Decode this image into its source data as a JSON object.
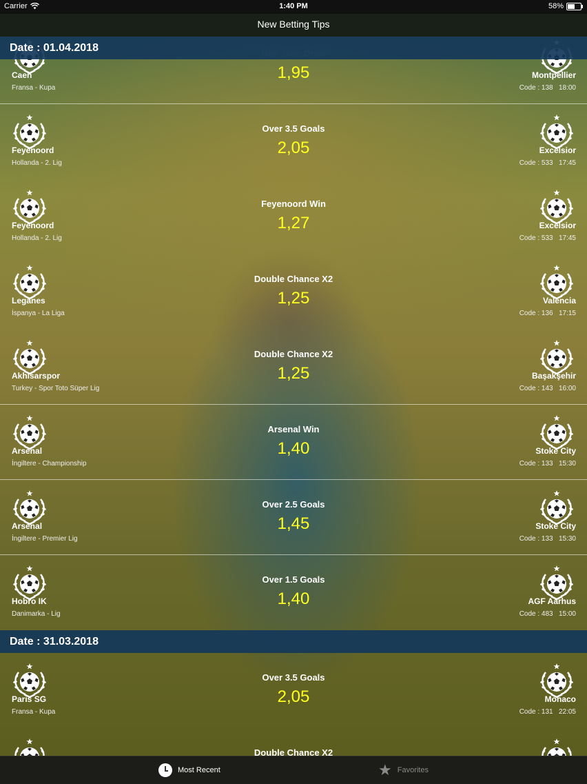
{
  "status_bar": {
    "carrier": "Carrier",
    "time": "1:40 PM",
    "battery": "58%",
    "battery_level": 0.58
  },
  "nav": {
    "title": "New Betting Tips"
  },
  "sections": [
    {
      "date": "Date : 01.04.2018",
      "matches": [
        {
          "home": "Caen",
          "league": "Fransa - Kupa",
          "tip": "Half Time Draw",
          "odds": "1,95",
          "away": "Montpellier",
          "code": "Code : 138",
          "time": "18:00"
        },
        {
          "home": "Feyenoord",
          "league": "Hollanda - 2. Lig",
          "tip": "Over 3.5 Goals",
          "odds": "2,05",
          "away": "Excelsior",
          "code": "Code : 533",
          "time": "17:45"
        },
        {
          "home": "Feyenoord",
          "league": "Hollanda - 2. Lig",
          "tip": "Feyenoord Win",
          "odds": "1,27",
          "away": "Excelsior",
          "code": "Code : 533",
          "time": "17:45"
        },
        {
          "home": "Leganes",
          "league": "İspanya - La Liga",
          "tip": "Double Chance X2",
          "odds": "1,25",
          "away": "Valencia",
          "code": "Code : 136",
          "time": "17:15"
        },
        {
          "home": "Akhisarspor",
          "league": "Turkey - Spor Toto Süper Lig",
          "tip": "Double Chance X2",
          "odds": "1,25",
          "away": "Başakşehir",
          "code": "Code : 143",
          "time": "16:00"
        },
        {
          "home": "Arsenal",
          "league": "İngiltere - Championship",
          "tip": "Arsenal Win",
          "odds": "1,40",
          "away": "Stoke City",
          "code": "Code : 133",
          "time": "15:30"
        },
        {
          "home": "Arsenal",
          "league": "İngiltere - Premier Lig",
          "tip": "Over 2.5 Goals",
          "odds": "1,45",
          "away": "Stoke City",
          "code": "Code : 133",
          "time": "15:30"
        },
        {
          "home": "Hobro IK",
          "league": "Danimarka - Lig",
          "tip": "Over 1.5 Goals",
          "odds": "1,40",
          "away": "AGF Aarhus",
          "code": "Code : 483",
          "time": "15:00"
        }
      ]
    },
    {
      "date": "Date : 31.03.2018",
      "matches": [
        {
          "home": "Paris SG",
          "league": "Fransa - Kupa",
          "tip": "Over 3.5 Goals",
          "odds": "2,05",
          "away": "Monaco",
          "code": "Code : 131",
          "time": "22:05"
        },
        {
          "home": "",
          "league": "",
          "tip": "Double Chance X2",
          "odds": "",
          "away": "",
          "code": "",
          "time": ""
        }
      ]
    }
  ],
  "tab_bar": {
    "recent": "Most Recent",
    "favorites": "Favorites"
  }
}
